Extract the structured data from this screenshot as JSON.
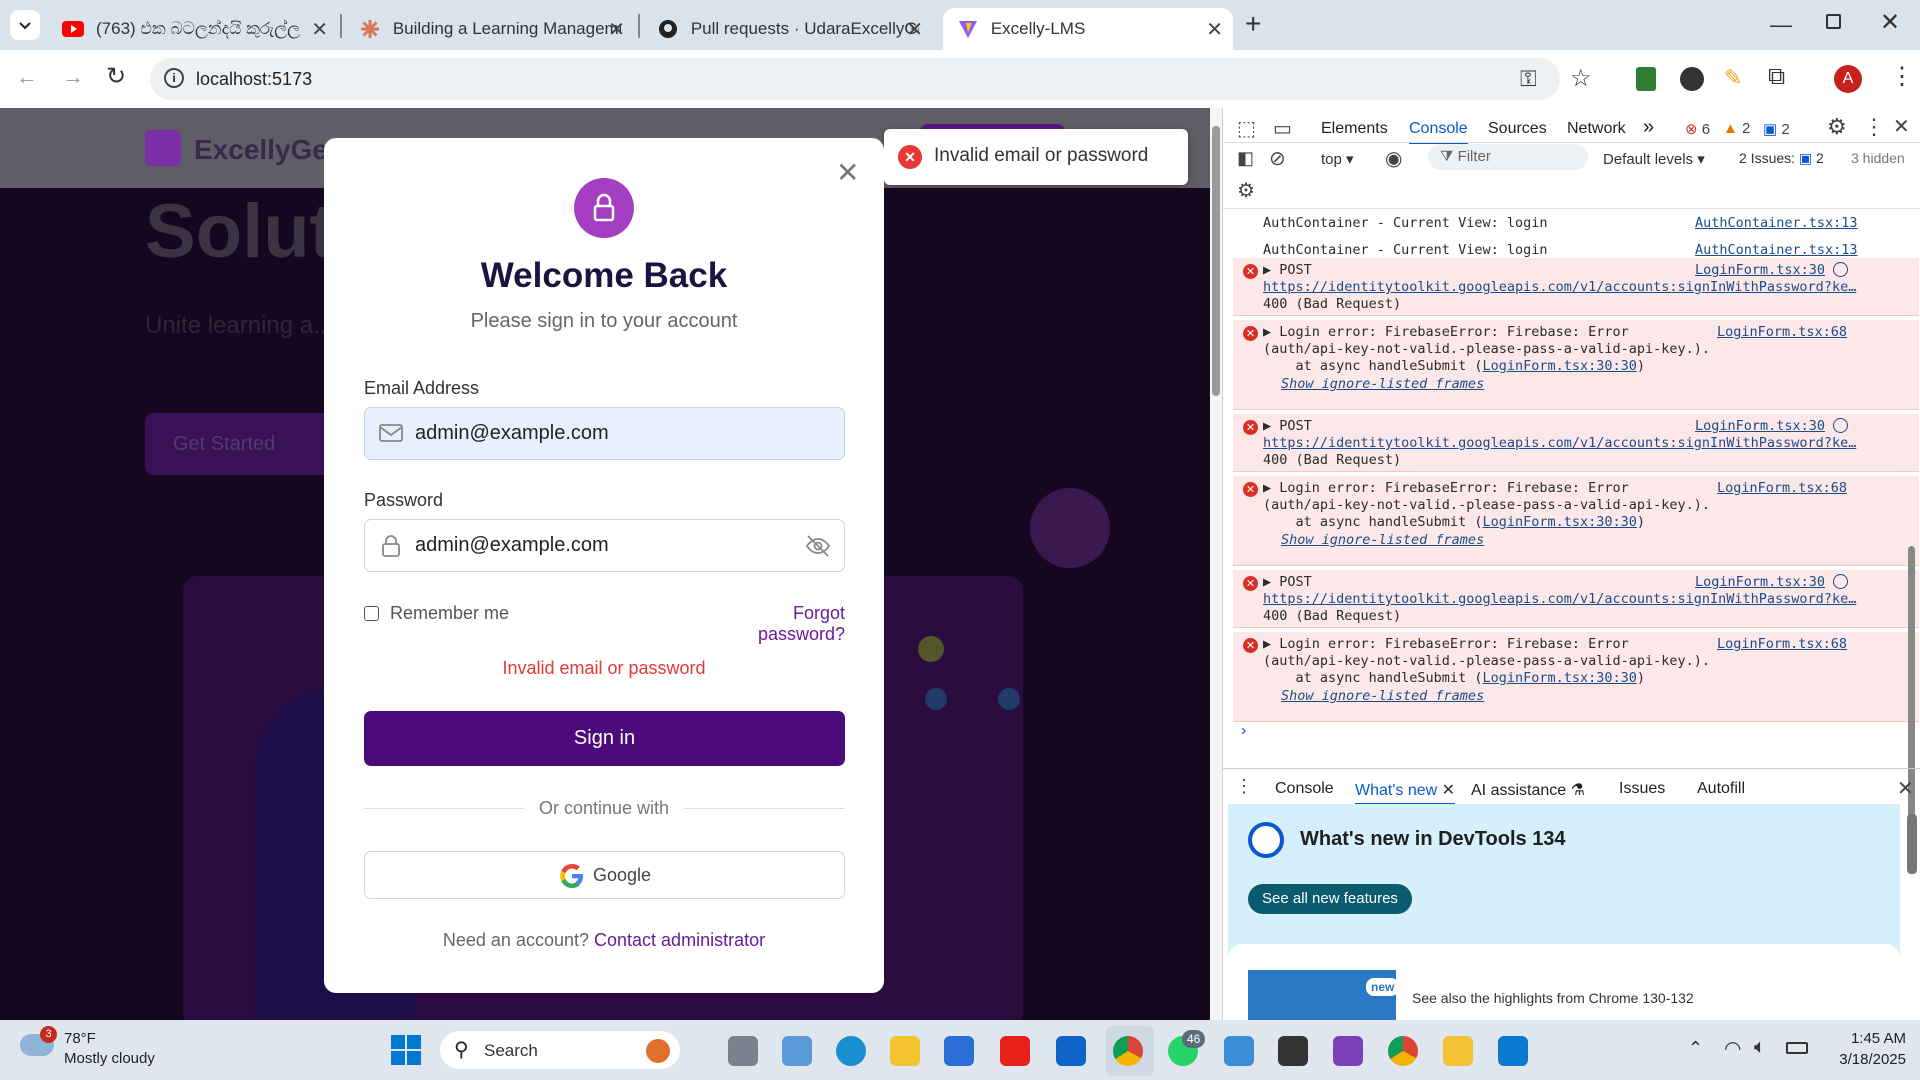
{
  "tabs": [
    {
      "title": "(763) එක බටලන්දයි කුරුල්ල",
      "favicon": "youtube-icon",
      "color": "#ff0000"
    },
    {
      "title": "Building a Learning Manageme",
      "favicon": "claude-icon",
      "color": "#d97757"
    },
    {
      "title": "Pull requests · UdaraExcellyGen",
      "favicon": "github-icon",
      "color": "#222222"
    },
    {
      "title": "Excelly-LMS",
      "favicon": "vite-icon",
      "color": "#8b5cf6"
    }
  ],
  "address": {
    "url": "localhost:5173",
    "profile_initial": "A"
  },
  "page_bg": {
    "logo": "ExcellyGen",
    "hero": "Solut",
    "tagline": "Unite learning a... ...tive employee growth, track pr... ...ng.",
    "cta": "Get Started"
  },
  "toast": {
    "message": "Invalid email or password"
  },
  "modal": {
    "title": "Welcome Back",
    "subtitle": "Please sign in to your account",
    "email_label": "Email Address",
    "email_value": "admin@example.com",
    "password_label": "Password",
    "password_value": "admin@example.com",
    "remember": "Remember me",
    "forgot": "Forgot password?",
    "error": "Invalid email or password",
    "signin": "Sign in",
    "divider": "Or continue with",
    "google": "Google",
    "footer_text": "Need an account?",
    "footer_link": "Contact administrator",
    "accent": "#4c0a7a"
  },
  "devtools": {
    "tabs": [
      "Elements",
      "Console",
      "Sources",
      "Network"
    ],
    "active_tab": "Console",
    "errors": "6",
    "warnings": "2",
    "messages": "2",
    "context": "top",
    "filter_placeholder": "Filter",
    "levels": "Default levels",
    "issues_label": "2 Issues:",
    "issues_count": "2",
    "hidden": "3 hidden",
    "logs": [
      {
        "text": "AuthContainer - Current View: login",
        "src": "AuthContainer.tsx:13"
      },
      {
        "text": "AuthContainer - Current View: login",
        "src": "AuthContainer.tsx:13"
      }
    ],
    "errors_list": [
      {
        "kind": "post",
        "head": "▶ POST",
        "src": "LoginForm.tsx:30",
        "url": "https://identitytoolkit.googleapis.com/v1/accounts:signInWithPassword?ke…",
        "status": "400 (Bad Request)"
      },
      {
        "kind": "err",
        "head": "▶ Login error: FirebaseError: Firebase: Error",
        "src": "LoginForm.tsx:68",
        "line2": "(auth/api-key-not-valid.-please-pass-a-valid-api-key.).",
        "line3a": "    at async handleSubmit (",
        "line3b": "LoginForm.tsx:30:30",
        "line3c": ")",
        "frames": "Show ignore-listed frames"
      },
      {
        "kind": "post",
        "head": "▶ POST",
        "src": "LoginForm.tsx:30",
        "url": "https://identitytoolkit.googleapis.com/v1/accounts:signInWithPassword?ke…",
        "status": "400 (Bad Request)"
      },
      {
        "kind": "err",
        "head": "▶ Login error: FirebaseError: Firebase: Error",
        "src": "LoginForm.tsx:68",
        "line2": "(auth/api-key-not-valid.-please-pass-a-valid-api-key.).",
        "line3a": "    at async handleSubmit (",
        "line3b": "LoginForm.tsx:30:30",
        "line3c": ")",
        "frames": "Show ignore-listed frames"
      },
      {
        "kind": "post",
        "head": "▶ POST",
        "src": "LoginForm.tsx:30",
        "url": "https://identitytoolkit.googleapis.com/v1/accounts:signInWithPassword?ke…",
        "status": "400 (Bad Request)"
      },
      {
        "kind": "err",
        "head": "▶ Login error: FirebaseError: Firebase: Error",
        "src": "LoginForm.tsx:68",
        "line2": "(auth/api-key-not-valid.-please-pass-a-valid-api-key.).",
        "line3a": "    at async handleSubmit (",
        "line3b": "LoginForm.tsx:30:30",
        "line3c": ")",
        "frames": "Show ignore-listed frames"
      }
    ],
    "drawer_tabs": [
      "Console",
      "What's new",
      "AI assistance",
      "Issues",
      "Autofill"
    ],
    "drawer_active": "What's new",
    "whatsnew_title": "What's new in DevTools 134",
    "whatsnew_button": "See all new features",
    "whatsnew_badge": "new",
    "whatsnew_highlight": "See also the highlights from Chrome 130-132"
  },
  "taskbar": {
    "weather_temp": "78°F",
    "weather_desc": "Mostly cloudy",
    "weather_badge": "3",
    "search": "Search",
    "whatsapp_badge": "46",
    "time": "1:45 AM",
    "date": "3/18/2025"
  }
}
